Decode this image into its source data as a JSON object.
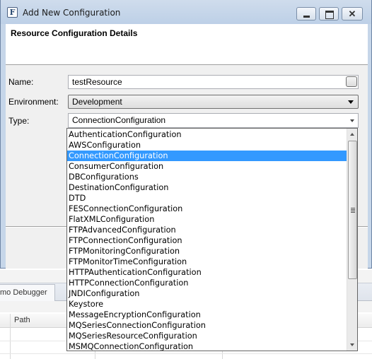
{
  "window": {
    "title": "Add New Configuration",
    "app_icon_letter": "F",
    "close_glyph": "✕"
  },
  "header": {
    "title": "Resource Configuration Details"
  },
  "form": {
    "name_label": "Name:",
    "name_value": "testResource",
    "environment_label": "Environment:",
    "environment_value": "Development",
    "type_label": "Type:",
    "type_value": "ConnectionConfiguration"
  },
  "type_dropdown": {
    "selected_index": 2,
    "items": [
      "AuthenticationConfiguration",
      "AWSConfiguration",
      "ConnectionConfiguration",
      "ConsumerConfiguration",
      "DBConfigurations",
      "DestinationConfiguration",
      "DTD",
      "FESConnectionConfiguration",
      "FlatXMLConfiguration",
      "FTPAdvancedConfiguration",
      "FTPConnectionConfiguration",
      "FTPMonitoringConfiguration",
      "FTPMonitorTimeConfiguration",
      "HTTPAuthenticationConfiguration",
      "HTTPConnectionConfiguration",
      "JNDIConfiguration",
      "Keystore",
      "MessageEncryptionConfiguration",
      "MQSeriesConnectionConfiguration",
      "MQSeriesResourceConfiguration",
      "MSMQConnectionConfiguration"
    ]
  },
  "background": {
    "tab_label": "mo Debugger",
    "column_header": "Path"
  },
  "colors": {
    "selection": "#3399ff",
    "titlebar": "#c6d6e9"
  }
}
